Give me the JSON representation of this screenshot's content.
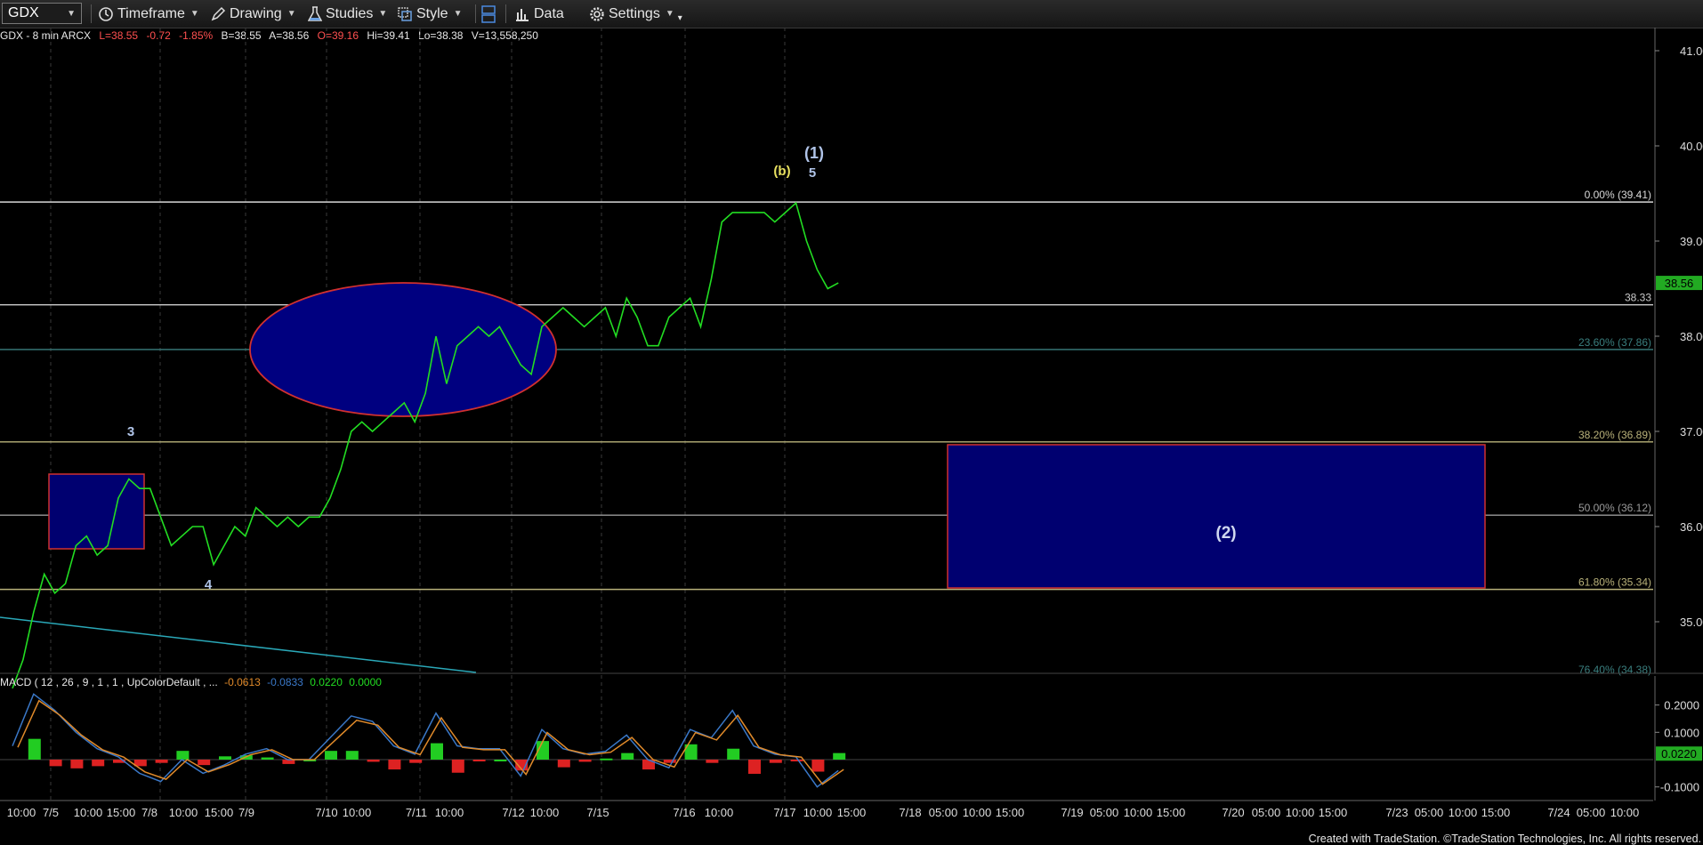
{
  "toolbar": {
    "symbol": "GDX",
    "timeframe": "Timeframe",
    "drawing": "Drawing",
    "studies": "Studies",
    "style": "Style",
    "data": "Data",
    "settings": "Settings"
  },
  "infobar": {
    "title": "GDX - 8 min  ARCX",
    "last": "L=38.55",
    "change": "-0.72",
    "pct": "-1.85%",
    "bid": "B=38.55",
    "ask": "A=38.56",
    "open": "O=39.16",
    "high": "Hi=39.41",
    "low": "Lo=38.38",
    "volume": "V=13,558,250"
  },
  "macd_label": {
    "text": "MACD ( 12 , 26 , 9 , 1 , 1 , UpColorDefault , ...",
    "v1": "-0.0613",
    "v2": "-0.0833",
    "v3": "0.0220",
    "v4": "0.0000"
  },
  "price_axis": [
    "41.00",
    "40.00",
    "39.00",
    "38.00",
    "37.00",
    "36.00",
    "35.00"
  ],
  "current_price": "38.56",
  "macd_axis": [
    "0.2000",
    "0.1000",
    "-0.1000"
  ],
  "macd_current": "0.0220",
  "fib_levels": [
    {
      "label": "0.00% (39.41)",
      "price": 39.41,
      "color": "#d8d8d8"
    },
    {
      "label": "23.60% (37.86)",
      "price": 37.86,
      "color": "#3a7f7f"
    },
    {
      "label": "38.20% (36.89)",
      "price": 36.89,
      "color": "#b9b27a"
    },
    {
      "label": "50.00% (36.12)",
      "price": 36.12,
      "color": "#9a9a9a"
    },
    {
      "label": "61.80% (35.34)",
      "price": 35.34,
      "color": "#b9b27a"
    },
    {
      "label": "76.40% (34.38)",
      "price": 34.38,
      "color": "#3a7f7f"
    }
  ],
  "horizontal_line": {
    "label": "38.33",
    "price": 38.33
  },
  "wave_labels": [
    {
      "text": "3",
      "color": "#b0c4e8"
    },
    {
      "text": "4",
      "color": "#b0c4e8"
    },
    {
      "text": "(b)",
      "color": "#e8e060"
    },
    {
      "text": "5",
      "color": "#b0c4e8"
    },
    {
      "text": "(1)",
      "color": "#b0c4e8"
    },
    {
      "text": "(2)",
      "color": "#d0d8f0"
    }
  ],
  "time_axis": [
    {
      "text": "10:00"
    },
    {
      "text": "7/5"
    },
    {
      "text": "10:00"
    },
    {
      "text": "15:00"
    },
    {
      "text": "7/8"
    },
    {
      "text": "10:00"
    },
    {
      "text": "15:00"
    },
    {
      "text": "7/9"
    },
    {
      "text": "7/10"
    },
    {
      "text": "10:00"
    },
    {
      "text": "7/11"
    },
    {
      "text": "10:00"
    },
    {
      "text": "7/12"
    },
    {
      "text": "10:00"
    },
    {
      "text": "7/15"
    },
    {
      "text": "7/16"
    },
    {
      "text": "10:00"
    },
    {
      "text": "7/17"
    },
    {
      "text": "10:00"
    },
    {
      "text": "15:00"
    },
    {
      "text": "7/18"
    },
    {
      "text": "05:00"
    },
    {
      "text": "10:00"
    },
    {
      "text": "15:00"
    },
    {
      "text": "7/19"
    },
    {
      "text": "05:00"
    },
    {
      "text": "10:00"
    },
    {
      "text": "15:00"
    },
    {
      "text": "7/20"
    },
    {
      "text": "05:00"
    },
    {
      "text": "10:00"
    },
    {
      "text": "15:00"
    },
    {
      "text": "7/23"
    },
    {
      "text": "05:00"
    },
    {
      "text": "10:00"
    },
    {
      "text": "15:00"
    },
    {
      "text": "7/24"
    },
    {
      "text": "05:00"
    },
    {
      "text": "10:00"
    }
  ],
  "footer": "Created with TradeStation. ©TradeStation Technologies, Inc. All rights reserved.",
  "colors": {
    "price": "#22dd22",
    "box_fill": "#000070",
    "box_border": "#d03030",
    "macd_line": "#3a78c8",
    "signal_line": "#e08a2a",
    "hist_up": "#22cc22",
    "hist_down": "#dd2222",
    "trendline": "#2aa8b8"
  },
  "chart_data": {
    "type": "line",
    "ylim": [
      34.38,
      41.1
    ],
    "close_path": [
      [
        0,
        34.3
      ],
      [
        2,
        34.6
      ],
      [
        4,
        35.1
      ],
      [
        6,
        35.5
      ],
      [
        8,
        35.3
      ],
      [
        10,
        35.4
      ],
      [
        12,
        35.8
      ],
      [
        14,
        35.9
      ],
      [
        16,
        35.7
      ],
      [
        18,
        35.8
      ],
      [
        20,
        36.3
      ],
      [
        22,
        36.5
      ],
      [
        24,
        36.4
      ],
      [
        26,
        36.4
      ],
      [
        28,
        36.1
      ],
      [
        30,
        35.8
      ],
      [
        32,
        35.9
      ],
      [
        34,
        36.0
      ],
      [
        36,
        36.0
      ],
      [
        38,
        35.6
      ],
      [
        40,
        35.8
      ],
      [
        42,
        36.0
      ],
      [
        44,
        35.9
      ],
      [
        46,
        36.2
      ],
      [
        48,
        36.1
      ],
      [
        50,
        36.0
      ],
      [
        52,
        36.1
      ],
      [
        54,
        36.0
      ],
      [
        56,
        36.1
      ],
      [
        58,
        36.1
      ],
      [
        60,
        36.3
      ],
      [
        62,
        36.6
      ],
      [
        64,
        37.0
      ],
      [
        66,
        37.1
      ],
      [
        68,
        37.0
      ],
      [
        70,
        37.1
      ],
      [
        72,
        37.2
      ],
      [
        74,
        37.3
      ],
      [
        76,
        37.1
      ],
      [
        78,
        37.4
      ],
      [
        80,
        38.0
      ],
      [
        82,
        37.5
      ],
      [
        84,
        37.9
      ],
      [
        86,
        38.0
      ],
      [
        88,
        38.1
      ],
      [
        90,
        38.0
      ],
      [
        92,
        38.1
      ],
      [
        94,
        37.9
      ],
      [
        96,
        37.7
      ],
      [
        98,
        37.6
      ],
      [
        100,
        38.1
      ],
      [
        102,
        38.2
      ],
      [
        104,
        38.3
      ],
      [
        106,
        38.2
      ],
      [
        108,
        38.1
      ],
      [
        110,
        38.2
      ],
      [
        112,
        38.3
      ],
      [
        114,
        38.0
      ],
      [
        116,
        38.4
      ],
      [
        118,
        38.2
      ],
      [
        120,
        37.9
      ],
      [
        122,
        37.9
      ],
      [
        124,
        38.2
      ],
      [
        126,
        38.3
      ],
      [
        128,
        38.4
      ],
      [
        130,
        38.1
      ],
      [
        132,
        38.6
      ],
      [
        134,
        39.2
      ],
      [
        136,
        39.3
      ],
      [
        138,
        39.3
      ],
      [
        140,
        39.3
      ],
      [
        142,
        39.3
      ],
      [
        144,
        39.2
      ],
      [
        146,
        39.3
      ],
      [
        148,
        39.4
      ],
      [
        150,
        39.0
      ],
      [
        152,
        38.7
      ],
      [
        154,
        38.5
      ],
      [
        156,
        38.56
      ]
    ],
    "macd": [
      [
        0,
        0.05
      ],
      [
        4,
        0.24
      ],
      [
        8,
        0.18
      ],
      [
        12,
        0.1
      ],
      [
        16,
        0.04
      ],
      [
        20,
        0.01
      ],
      [
        24,
        -0.05
      ],
      [
        28,
        -0.08
      ],
      [
        32,
        0.0
      ],
      [
        36,
        -0.05
      ],
      [
        40,
        -0.02
      ],
      [
        44,
        0.02
      ],
      [
        48,
        0.04
      ],
      [
        52,
        0.0
      ],
      [
        56,
        0.0
      ],
      [
        60,
        0.08
      ],
      [
        64,
        0.16
      ],
      [
        68,
        0.14
      ],
      [
        72,
        0.05
      ],
      [
        76,
        0.02
      ],
      [
        80,
        0.17
      ],
      [
        84,
        0.05
      ],
      [
        88,
        0.04
      ],
      [
        92,
        0.04
      ],
      [
        96,
        -0.06
      ],
      [
        100,
        0.11
      ],
      [
        104,
        0.04
      ],
      [
        108,
        0.02
      ],
      [
        112,
        0.03
      ],
      [
        116,
        0.09
      ],
      [
        120,
        0.0
      ],
      [
        124,
        -0.03
      ],
      [
        128,
        0.11
      ],
      [
        132,
        0.08
      ],
      [
        136,
        0.18
      ],
      [
        140,
        0.05
      ],
      [
        144,
        0.02
      ],
      [
        148,
        0.01
      ],
      [
        152,
        -0.1
      ],
      [
        156,
        -0.04
      ]
    ]
  }
}
